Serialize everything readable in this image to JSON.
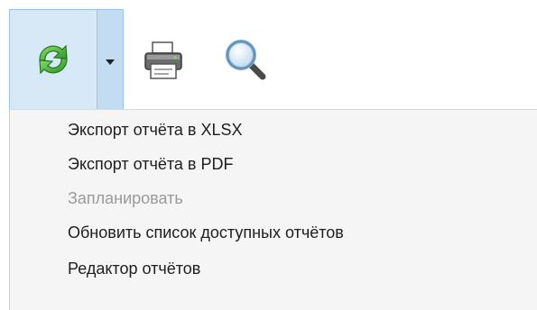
{
  "toolbar": {
    "buttons": [
      {
        "name": "refresh",
        "icon": "refresh-icon",
        "colors": [
          "#2e9e2a",
          "#7ed957"
        ]
      },
      {
        "name": "print",
        "icon": "printer-icon"
      },
      {
        "name": "search",
        "icon": "magnifier-icon"
      }
    ],
    "dropdown_icon": "chevron-down-icon",
    "active_background": "#d7e8f6"
  },
  "menu": {
    "items": [
      {
        "label": "Экспорт отчёта в XLSX",
        "enabled": true
      },
      {
        "label": "Экспорт отчёта в PDF",
        "enabled": true
      },
      {
        "label": "Запланировать",
        "enabled": false
      },
      {
        "label": "Обновить список доступных отчётов",
        "enabled": true
      },
      {
        "label": "Редактор отчётов",
        "enabled": true
      }
    ]
  }
}
